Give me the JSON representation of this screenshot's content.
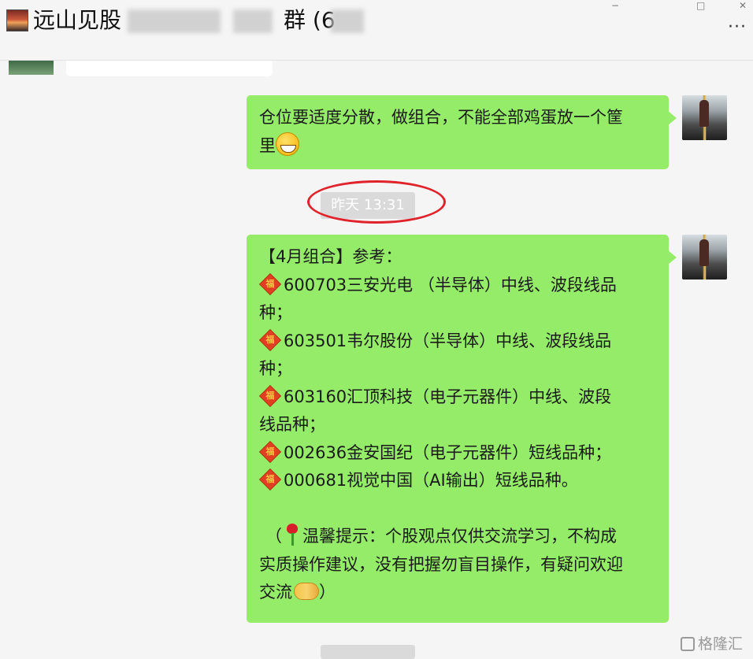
{
  "header": {
    "title": "远山见股",
    "title_suffix": "群 (6",
    "window_controls": {
      "minimize": "−",
      "maximize": "□",
      "close": "✕"
    },
    "more_icon": "more-horizontal-icon",
    "group_icon": "group-avatar-icon"
  },
  "messages": [
    {
      "side": "right",
      "lines": [
        "仓位要适度分散，做组合，不能全部鸡蛋放一个筐",
        "里"
      ],
      "trailing_emoji": "grinning-face-emoji"
    },
    {
      "side": "right",
      "header": "【4月组合】参考：",
      "stocks": [
        {
          "icon": "fu-diamond-emoji",
          "line1": "600703三安光电 （半导体）中线、波段线品",
          "line2": "种；"
        },
        {
          "icon": "fu-diamond-emoji",
          "line1": "603501韦尔股份（半导体）中线、波段线品",
          "line2": "种；"
        },
        {
          "icon": "fu-diamond-emoji",
          "line1": "603160汇顶科技（电子元器件）中线、波段",
          "line2": "线品种；"
        },
        {
          "icon": "fu-diamond-emoji",
          "line1": "002636金安国纪（电子元器件）短线品种；",
          "line2": ""
        },
        {
          "icon": "fu-diamond-emoji",
          "line1": "000681视觉中国（AI输出）短线品种。",
          "line2": ""
        }
      ],
      "notice_prefix": "（",
      "notice_line1": "温馨提示：个股观点仅供交流学习，不构成",
      "notice_line2": "实质操作建议，没有把握勿盲目操作，有疑问欢迎",
      "notice_line3": "交流",
      "notice_suffix": "）",
      "fu_char": "福"
    }
  ],
  "timestamp": "昨天 13:31",
  "watermark": "格隆汇",
  "colors": {
    "bubble_green": "#95ec69",
    "annotation_red": "#e0232b",
    "background": "#f5f5f5"
  }
}
